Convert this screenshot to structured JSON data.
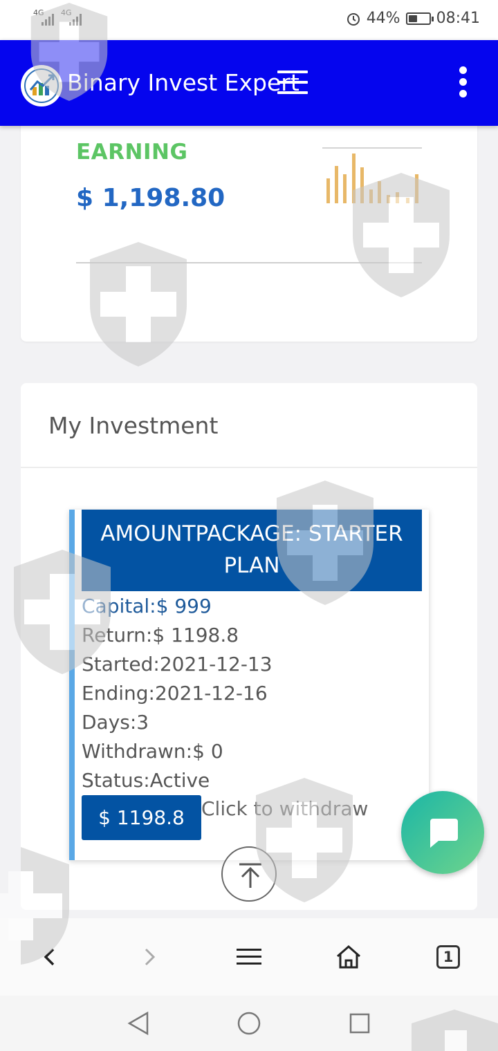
{
  "status_bar": {
    "signal_1": "4G",
    "signal_2": "4G",
    "battery_percent": "44%",
    "battery_level": 0.44,
    "time": "08:41"
  },
  "app_bar": {
    "title": "Binary Invest Expert"
  },
  "earning": {
    "label": "EARNING",
    "value": "$ 1,198.80"
  },
  "investment": {
    "title": "My Investment",
    "package": {
      "heading": "AMOUNTPACKAGE: STARTER PLAN",
      "capital": "Capital:$ 999",
      "return": "Return:$ 1198.8",
      "started": "Started:2021-12-13",
      "ending": "Ending:2021-12-16",
      "days": "Days:3",
      "withdrawn": "Withdrawn:$ 0",
      "status": "Status:Active",
      "button_label": "$ 1198.8",
      "withdraw_text": "Click to withdraw"
    }
  },
  "browser_toolbar": {
    "tab_count": "1"
  },
  "colors": {
    "app_bar": "#0505ee",
    "earning_label": "#5cc564",
    "earning_value": "#2267c3",
    "package_header": "#0353a3",
    "chat_fab_start": "#1bb6a6",
    "chat_fab_end": "#6ed48c"
  },
  "icons": [
    "alarm-icon",
    "battery-icon",
    "logo-icon",
    "hamburger-menu-icon",
    "more-vert-icon",
    "chart-sparkline-icon",
    "scroll-top-icon",
    "chat-icon",
    "back-icon",
    "forward-icon",
    "menu-icon",
    "home-icon",
    "tabs-icon",
    "nav-back-icon",
    "nav-home-icon",
    "nav-recents-icon",
    "shield-cross-icon"
  ]
}
